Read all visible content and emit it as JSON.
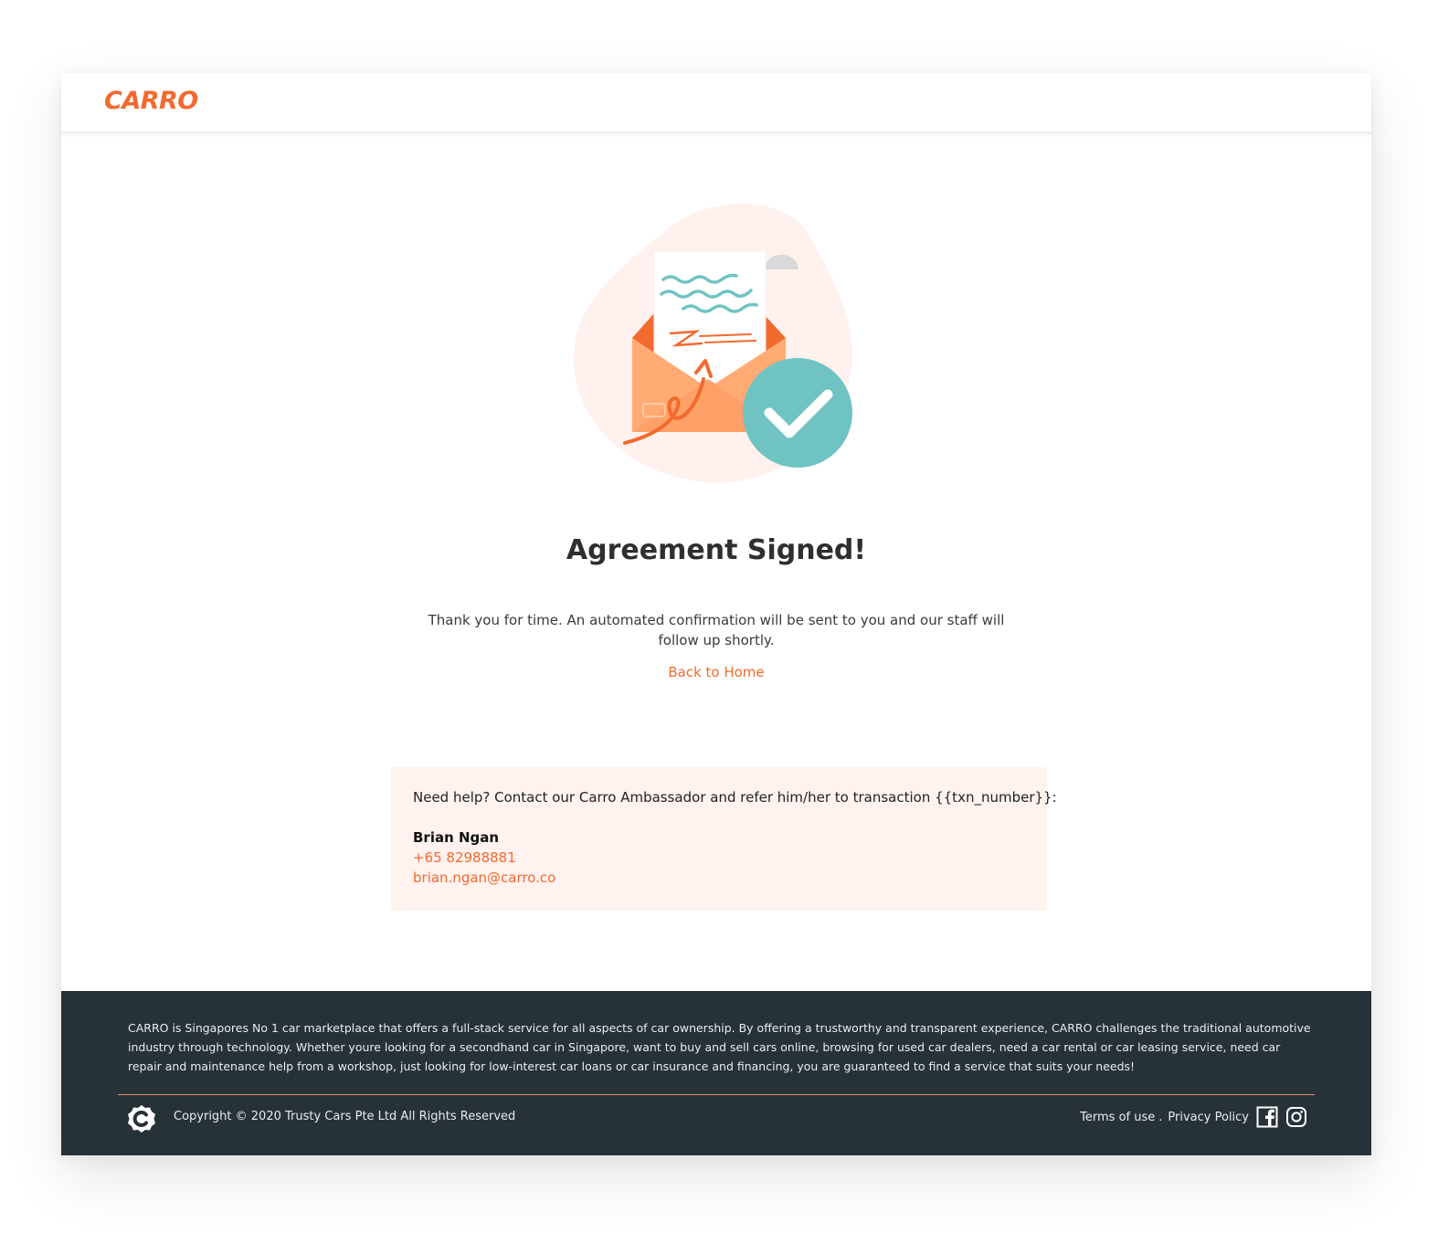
{
  "brand": {
    "logo_text": "CARRO",
    "accent_color": "#f26a2e",
    "teal_color": "#6fc3c3",
    "footer_bg": "#263238"
  },
  "confirmation": {
    "title": "Agreement Signed!",
    "message": "Thank you for time. An automated confirmation  will be sent to you and our staff will follow up shortly.",
    "back_link": "Back to Home",
    "illustration_icon": "signed-envelope-check-icon"
  },
  "help": {
    "intro": "Need help? Contact our Carro Ambassador and refer him/her to transaction {{txn_number}}:",
    "ambassador_name": "Brian Ngan",
    "ambassador_phone": "+65 82988881",
    "ambassador_email": "brian.ngan@carro.co"
  },
  "footer": {
    "about": "CARRO is Singapores No 1 car marketplace that offers a full-stack service for all aspects of car ownership. By offering a trustworthy and transparent experience, CARRO challenges the traditional automotive industry through technology. Whether youre looking for a secondhand car in Singapore, want to buy and sell cars online, browsing for used car dealers, need a car rental or car leasing service, need car repair and maintenance help from a workshop, just looking for low-interest car loans or car insurance and financing, you are guaranteed to find a service that suits your needs!",
    "copyright": "Copyright © 2020 Trusty Cars Pte Ltd All Rights Reserved",
    "terms": "Terms of use",
    "separator": ".",
    "privacy": "Privacy Policy",
    "social_icons": [
      "facebook-icon",
      "instagram-icon"
    ]
  }
}
